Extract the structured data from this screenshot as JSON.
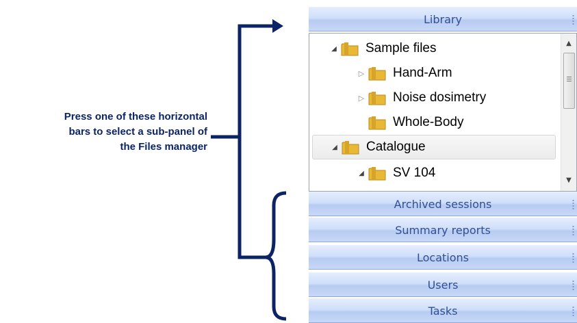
{
  "callout": {
    "line1": "Press one of these horizontal",
    "line2": "bars to select a sub-panel of",
    "line3": "the Files manager"
  },
  "panel": {
    "library_bar": "Library",
    "tree": [
      {
        "label": "Sample files",
        "state": "expanded"
      },
      {
        "label": "Hand-Arm",
        "state": "collapsed"
      },
      {
        "label": "Noise dosimetry",
        "state": "collapsed"
      },
      {
        "label": "Whole-Body",
        "state": "leaf"
      },
      {
        "label": "Catalogue",
        "state": "expanded",
        "selected": true
      },
      {
        "label": "SV 104",
        "state": "expanded"
      }
    ],
    "bars": [
      "Archived sessions",
      "Summary reports",
      "Locations",
      "Users",
      "Tasks"
    ]
  },
  "colors": {
    "annotation": "#0c2466",
    "bar_text": "#314f91",
    "folder": "#e9b935"
  },
  "icons": {
    "folder": "folder-icon",
    "expanded": "triangle-down-icon",
    "collapsed": "triangle-right-icon"
  }
}
